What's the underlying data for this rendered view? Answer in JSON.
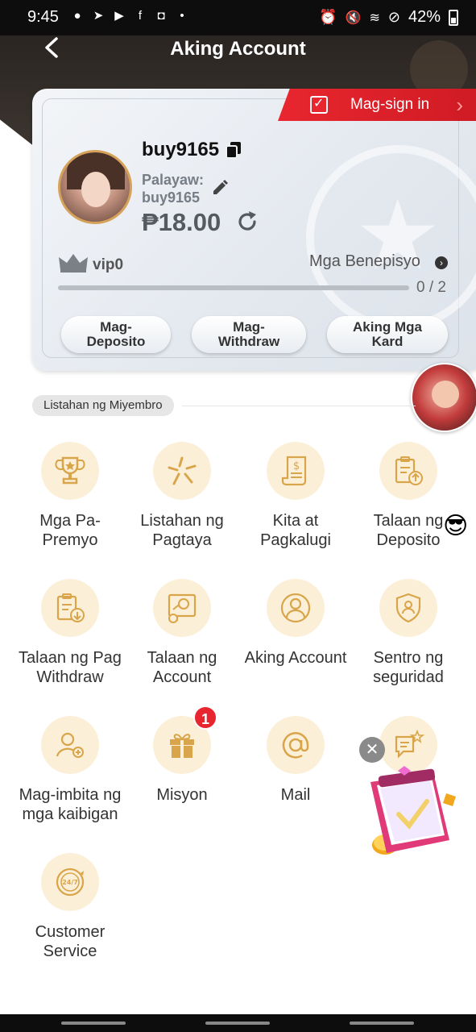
{
  "status_bar": {
    "time": "9:45",
    "battery": "42%"
  },
  "header": {
    "title": "Aking Account"
  },
  "sign_in": {
    "label": "Mag-sign in"
  },
  "profile": {
    "username": "buy9165",
    "nickname_label": "Palayaw:",
    "nickname_value": "buy9165",
    "balance": "₱18.00"
  },
  "vip": {
    "level": "vip0",
    "benefits_label": "Mga Benepisyo",
    "progress_text": "0 / 2",
    "progress_fraction": 0
  },
  "actions": {
    "deposit": [
      "Mag-",
      "Deposito"
    ],
    "withdraw": [
      "Mag-",
      "Withdraw"
    ],
    "cards": [
      "Aking Mga",
      "Kard"
    ]
  },
  "section": {
    "title": "Listahan ng Miyembro"
  },
  "menu": {
    "rewards": [
      "Mga Pa-",
      "Premyo"
    ],
    "bet_list": [
      "Listahan ng",
      "Pagtaya"
    ],
    "profit_loss": [
      "Kita at",
      "Pagkalugi"
    ],
    "deposit_record": [
      "Talaan ng",
      "Deposito"
    ],
    "withdraw_record": [
      "Talaan ng Pag",
      "Withdraw"
    ],
    "account_record": [
      "Talaan ng",
      "Account"
    ],
    "my_account": [
      "Aking Account"
    ],
    "security": [
      "Sentro ng",
      "seguridad"
    ],
    "invite": [
      "Mag-imbita ng",
      "mga kaibigan"
    ],
    "mission": [
      "Misyon"
    ],
    "mail": [
      "Mail"
    ],
    "customer_service": [
      "Customer",
      "Service"
    ]
  },
  "mission_badge": "1",
  "colors": {
    "accent_red": "#e8262f",
    "icon_gold": "#d9a54a",
    "icon_bg": "#fcefd7"
  }
}
